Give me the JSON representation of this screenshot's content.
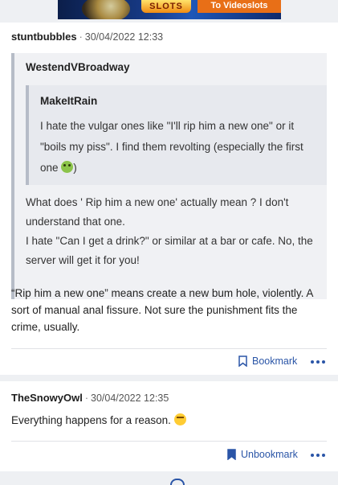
{
  "ad": {
    "slots_text": "SLOTS",
    "cta_text": "To Videoslots"
  },
  "posts": [
    {
      "author": "stuntbubbles",
      "timestamp": "30/04/2022 12:33",
      "quote": {
        "author": "WestendVBroadway",
        "nested_quote": {
          "author": "MakeItRain",
          "text": "I hate the vulgar ones like \"I'll rip him a new one\" or it \"boils my piss\". I find them revolting (especially the first one",
          "text_end": ")"
        },
        "line1": "What does ' Rip him a new one' actually mean ? I don't understand that one.",
        "line2": "I hate \"Can I get a drink?\" or similar at a bar or cafe. No, the server will get it for you!"
      },
      "reply": "“Rip him a new one” means create a new bum hole, violently. A sort of manual anal fissure. Not sure the punishment fits the crime, usually.",
      "action_label": "Bookmark"
    },
    {
      "author": "TheSnowyOwl",
      "timestamp": "30/04/2022 12:35",
      "text": "Everything happens for a reason.",
      "action_label": "Unbookmark"
    }
  ],
  "icons": {
    "bookmark": "bookmark-outline-icon",
    "unbookmark": "bookmark-filled-icon",
    "more": "more-dots-icon",
    "emoji_sick": "nauseated-face-emoji",
    "emoji_eyes": "eye-roll-emoji"
  },
  "colors": {
    "link": "#2a55a7",
    "quote_bg": "#f0f1f4",
    "quote_border": "#b6bcc7"
  }
}
